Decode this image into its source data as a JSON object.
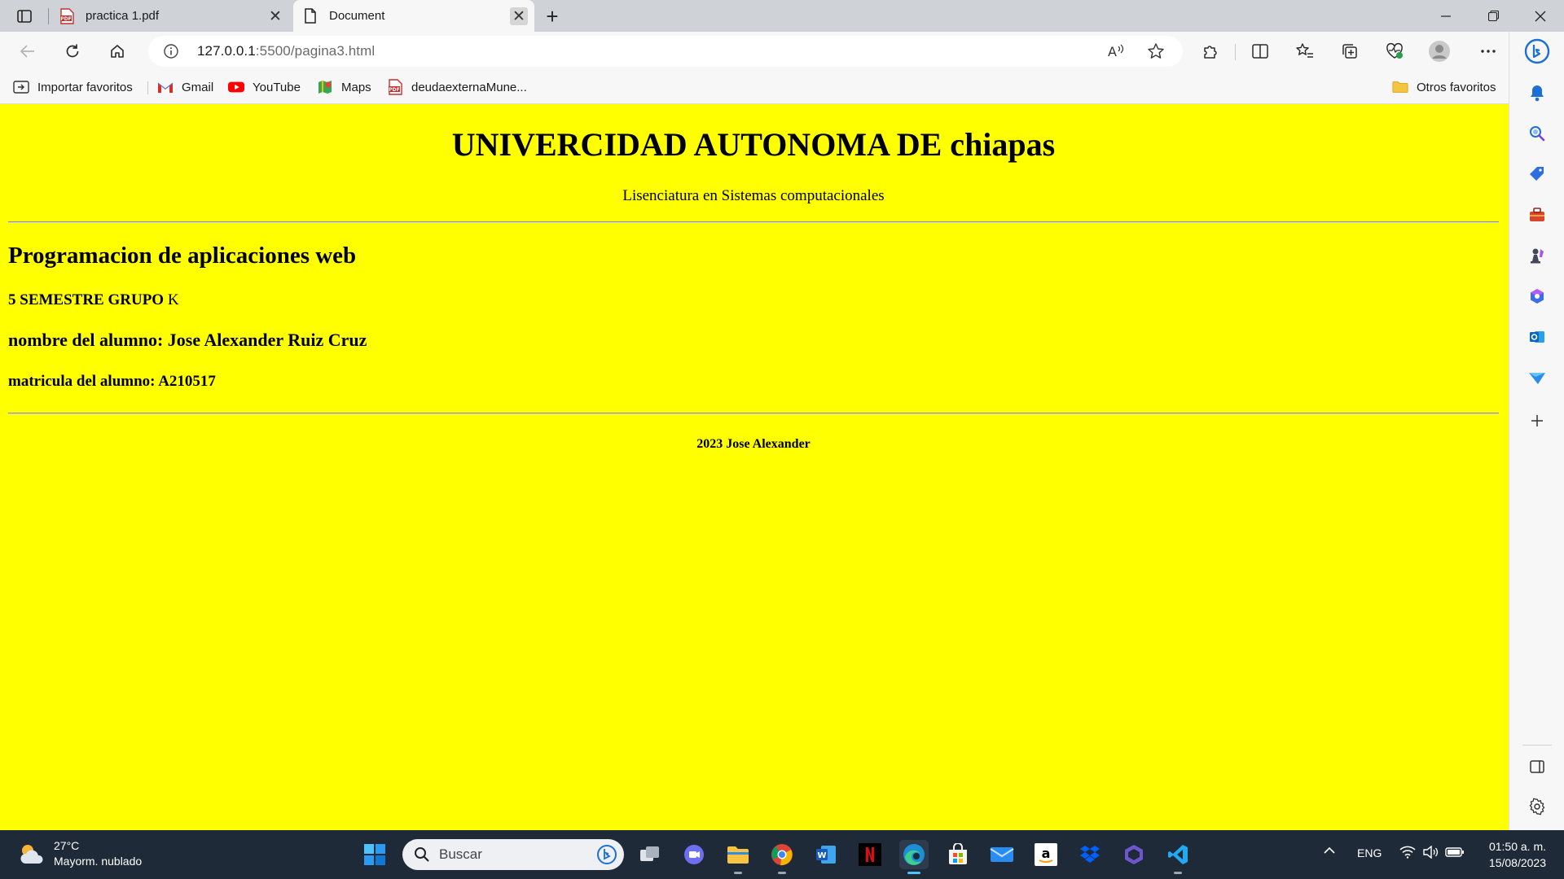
{
  "browser": {
    "tabs": [
      {
        "title": "practica 1.pdf",
        "icon": "pdf-icon",
        "active": false
      },
      {
        "title": "Document",
        "icon": "page-icon",
        "active": true
      }
    ],
    "address": {
      "host": "127.0.0.1",
      "rest": ":5500/pagina3.html"
    },
    "bookmarks": [
      {
        "label": "Importar favoritos",
        "icon": "import-icon"
      },
      {
        "label": "Gmail",
        "icon": "gmail-icon"
      },
      {
        "label": "YouTube",
        "icon": "youtube-icon"
      },
      {
        "label": "Maps",
        "icon": "maps-icon"
      },
      {
        "label": "deudaexternaMune...",
        "icon": "pdf-icon"
      }
    ],
    "other_favorites": "Otros favoritos"
  },
  "page": {
    "title": "UNIVERCIDAD AUTONOMA DE chiapas",
    "subtitle": "Lisenciatura en Sistemas computacionales",
    "course": "Programacion de aplicaciones web",
    "semester_bold": "5 SEMESTRE GRUPO",
    "semester_group": " K",
    "student_name": "nombre del alumno: Jose Alexander Ruiz Cruz",
    "student_id": "matricula del alumno: A210517",
    "footer": "2023 Jose Alexander",
    "background": "#ffff00"
  },
  "taskbar": {
    "weather_temp": "27°C",
    "weather_desc": "Mayorm. nublado",
    "search_placeholder": "Buscar",
    "language": "ENG",
    "time": "01:50 a. m.",
    "date": "15/08/2023"
  },
  "colors": {
    "accent": "#0a66c2",
    "edge_blue": "#1b6fd6",
    "taskbar": "#1f2a38"
  }
}
